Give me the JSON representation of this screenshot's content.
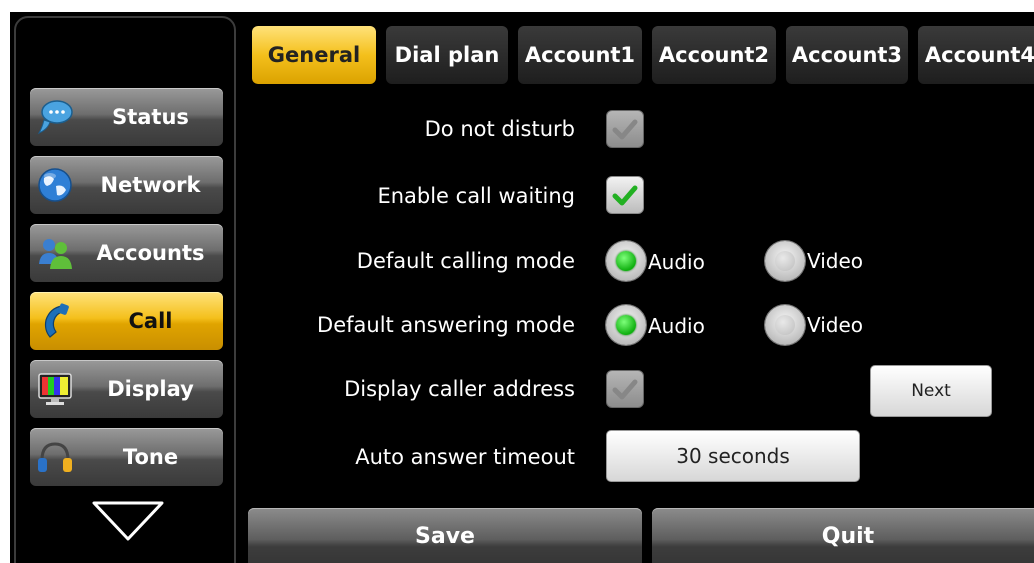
{
  "sidebar": {
    "items": [
      {
        "label": "Status",
        "icon": "chat-bubble-icon",
        "active": false
      },
      {
        "label": "Network",
        "icon": "globe-icon",
        "active": false
      },
      {
        "label": "Accounts",
        "icon": "users-icon",
        "active": false
      },
      {
        "label": "Call",
        "icon": "phone-handset-icon",
        "active": true
      },
      {
        "label": "Display",
        "icon": "monitor-icon",
        "active": false
      },
      {
        "label": "Tone",
        "icon": "headphones-icon",
        "active": false
      }
    ],
    "more_icon": "triangle-down-icon"
  },
  "tabs": [
    {
      "label": "General",
      "active": true
    },
    {
      "label": "Dial plan",
      "active": false
    },
    {
      "label": "Account1",
      "active": false
    },
    {
      "label": "Account2",
      "active": false
    },
    {
      "label": "Account3",
      "active": false
    },
    {
      "label": "Account4",
      "active": false
    }
  ],
  "settings": {
    "do_not_disturb": {
      "label": "Do not disturb",
      "checked": true,
      "enabled": false
    },
    "call_waiting": {
      "label": "Enable call waiting",
      "checked": true,
      "enabled": true
    },
    "calling_mode": {
      "label": "Default calling mode",
      "options": [
        "Audio",
        "Video"
      ],
      "selected": "Audio"
    },
    "answering_mode": {
      "label": "Default answering mode",
      "options": [
        "Audio",
        "Video"
      ],
      "selected": "Audio"
    },
    "caller_address": {
      "label": "Display caller address",
      "checked": true,
      "enabled": false
    },
    "auto_answer": {
      "label": "Auto answer timeout",
      "value": "30 seconds"
    }
  },
  "next_label": "Next",
  "footer": {
    "save_label": "Save",
    "quit_label": "Quit"
  },
  "colors": {
    "accent": "#f4c01c",
    "background": "#000000",
    "check_green": "#22b022"
  }
}
